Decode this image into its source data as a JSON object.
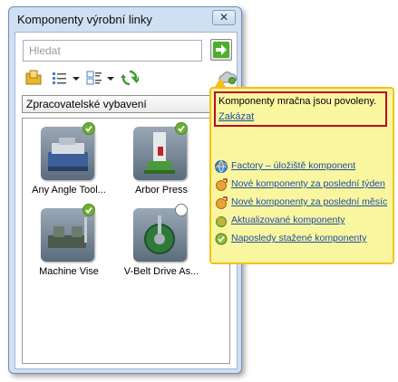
{
  "window": {
    "title": "Komponenty výrobní linky",
    "close_glyph": "✕"
  },
  "search": {
    "placeholder": "Hledat",
    "value": "",
    "go_icon": "green-arrow-right-icon"
  },
  "toolbar": {
    "icons": [
      "library-folder-icon",
      "list-view-icon",
      "details-view-icon",
      "refresh-icon",
      "cloud-icon"
    ]
  },
  "category": {
    "selected": "Zpracovatelské vybavení"
  },
  "components": [
    {
      "label": "Any Angle Tool...",
      "status": "checked"
    },
    {
      "label": "Arbor Press",
      "status": "checked"
    },
    {
      "label": "Machine Vise",
      "status": "checked"
    },
    {
      "label": "V-Belt Drive As...",
      "status": "empty"
    }
  ],
  "tooltip": {
    "status_text": "Komponenty mračna jsou povoleny.",
    "disable_link": "Zakázat",
    "links": [
      {
        "label": "Factory – úložiště komponent",
        "icon": "globe-icon"
      },
      {
        "label": "Nové komponenty za poslední týden",
        "icon": "new-component-icon"
      },
      {
        "label": "Nové komponenty za poslední měsíc",
        "icon": "new-component-icon"
      },
      {
        "label": "Aktualizované komponenty",
        "icon": "updated-component-icon"
      },
      {
        "label": "Naposledy stažené komponenty",
        "icon": "downloaded-check-icon"
      }
    ]
  },
  "colors": {
    "tooltip_bg": "#faf6a0",
    "tooltip_border": "#f2c21a",
    "highlight_box": "#b80d25",
    "link": "#1c4ea0",
    "check_green": "#6cae3a"
  }
}
